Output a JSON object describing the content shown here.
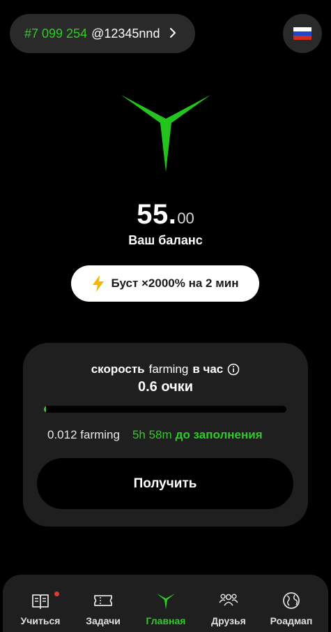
{
  "header": {
    "rank": "#7 099 254",
    "username": "@12345nnd",
    "language_flag": "russia-flag-icon"
  },
  "balance": {
    "integer": "55.",
    "decimals": "00",
    "label": "Ваш баланс"
  },
  "boost": {
    "icon": "lightning-icon",
    "label": "Буст ×2000% на 2 мин"
  },
  "farming_card": {
    "rate_prefix": "скорость",
    "rate_word": "farming",
    "rate_suffix": "в час",
    "points": "0.6 очки",
    "progress_fraction": 0.01,
    "amount": "0.012 farming",
    "time_left": "5h 58m",
    "until_label": "до заполнения",
    "claim_label": "Получить"
  },
  "nav": {
    "items": [
      {
        "label": "Учиться",
        "icon": "book-icon",
        "active": false,
        "notification": true
      },
      {
        "label": "Задачи",
        "icon": "ticket-icon",
        "active": false
      },
      {
        "label": "Главная",
        "icon": "logo-icon",
        "active": true
      },
      {
        "label": "Друзья",
        "icon": "friends-icon",
        "active": false
      },
      {
        "label": "Роадмап",
        "icon": "globe-icon",
        "active": false
      }
    ]
  },
  "colors": {
    "accent": "#2fcc26",
    "background": "#000000",
    "card": "#1f1f1f"
  }
}
